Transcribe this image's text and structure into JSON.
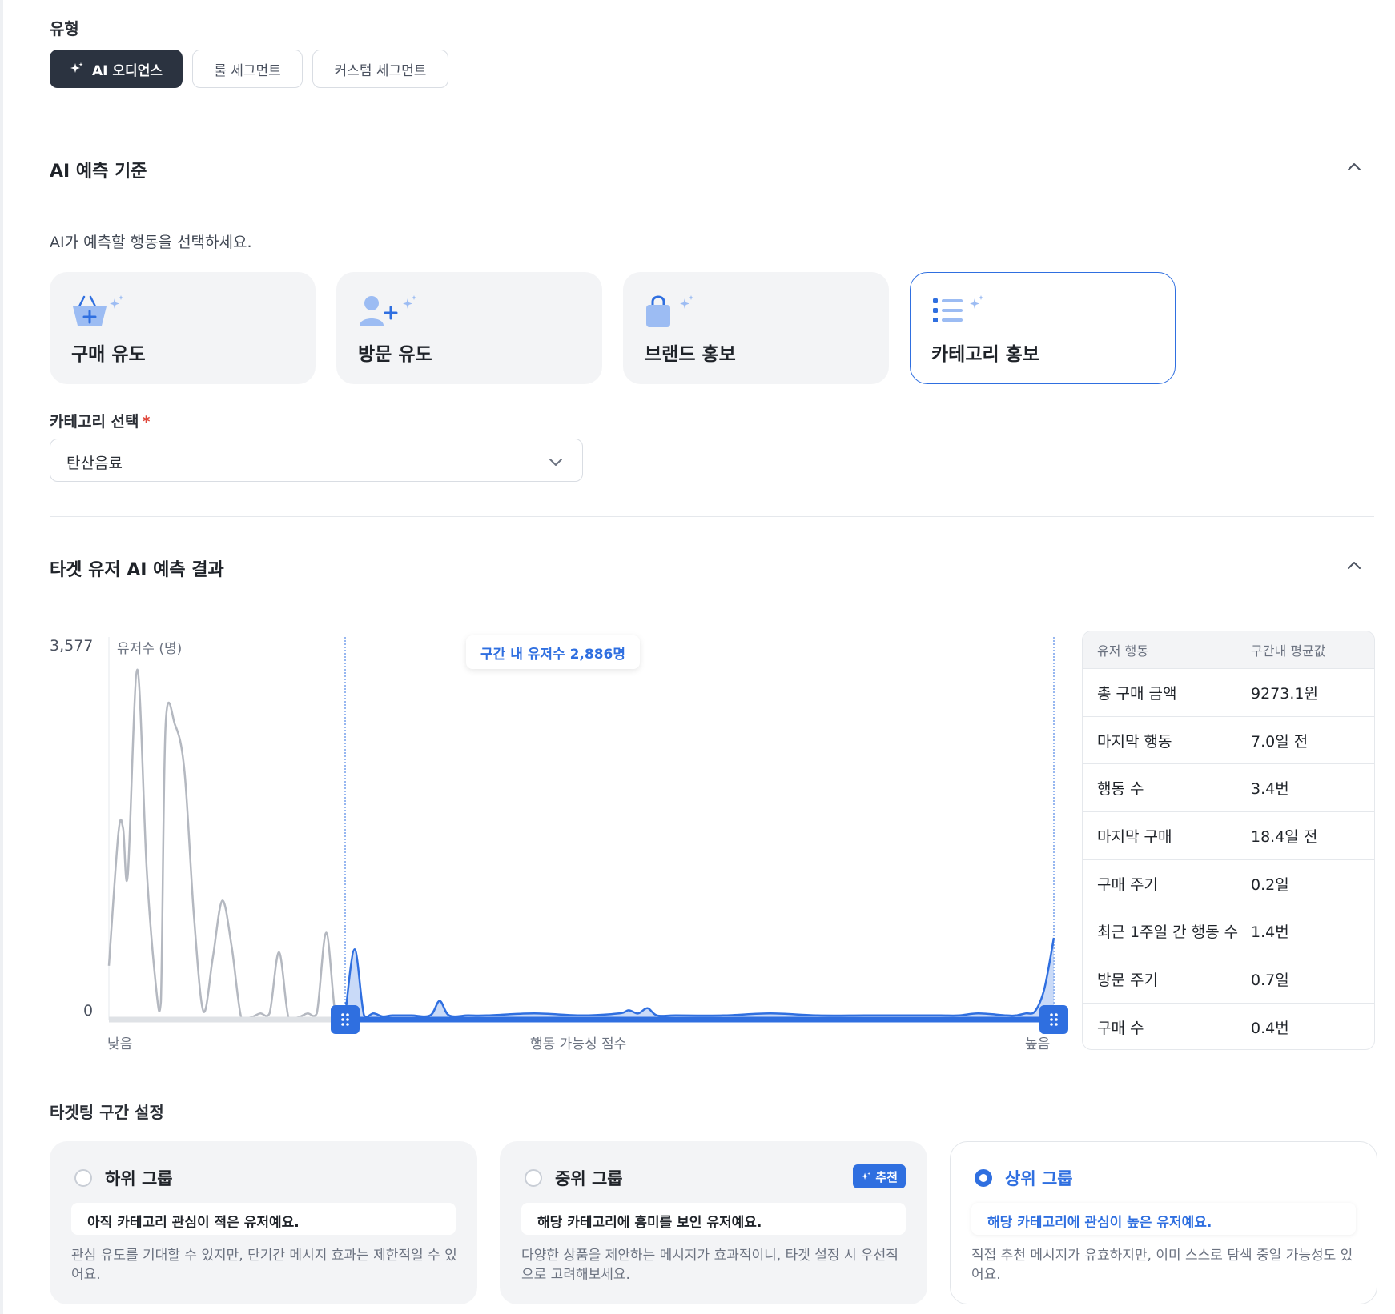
{
  "type_section": {
    "label": "유형",
    "tabs": [
      {
        "label": "AI 오디언스",
        "active": true,
        "icon": "sparkle-icon"
      },
      {
        "label": "룰 세그먼트",
        "active": false
      },
      {
        "label": "커스텀 세그먼트",
        "active": false
      }
    ]
  },
  "prediction": {
    "title": "AI 예측 기준",
    "hint": "AI가 예측할 행동을 선택하세요.",
    "options": [
      {
        "label": "구매 유도",
        "icon": "basket-plus-icon",
        "selected": false
      },
      {
        "label": "방문 유도",
        "icon": "user-plus-icon",
        "selected": false
      },
      {
        "label": "브랜드 홍보",
        "icon": "shopping-bag-icon",
        "selected": false
      },
      {
        "label": "카테고리 홍보",
        "icon": "list-icon",
        "selected": true
      }
    ],
    "category_label": "카테고리 선택",
    "required_mark": "*",
    "category_value": "탄산음료"
  },
  "result": {
    "title": "타겟 유저 AI 예측 결과"
  },
  "chart_data": {
    "type": "area",
    "y_axis_title": "유저수 (명)",
    "ylim": [
      0,
      3577
    ],
    "y_ticks": [
      "3,577",
      "0"
    ],
    "x_axis_title": "행동 가능성 점수",
    "x_tick_low": "낮음",
    "x_tick_high": "높음",
    "xlim": [
      0,
      100
    ],
    "selected_range": [
      25,
      100
    ],
    "range_label": "구간 내 유저수 2,886명",
    "series": [
      {
        "x": [
          0,
          1,
          1.5,
          2,
          3,
          4,
          5,
          5.5,
          6,
          7,
          8,
          9,
          10,
          11,
          12,
          13,
          14,
          15,
          16,
          17,
          18,
          19,
          20,
          21,
          22,
          23,
          24,
          25,
          26,
          27,
          28,
          29,
          30,
          32,
          34,
          35,
          36,
          38,
          40,
          45,
          50,
          54,
          55,
          56,
          57,
          58,
          60,
          65,
          70,
          75,
          80,
          85,
          88,
          90,
          92,
          95,
          96,
          97,
          98,
          99,
          100
        ],
        "values": [
          520,
          1800,
          1850,
          1400,
          3385,
          1450,
          300,
          170,
          2850,
          2850,
          2400,
          1000,
          80,
          600,
          1150,
          700,
          20,
          20,
          60,
          60,
          650,
          20,
          20,
          60,
          60,
          840,
          30,
          40,
          680,
          40,
          60,
          30,
          40,
          40,
          40,
          180,
          40,
          40,
          40,
          60,
          40,
          60,
          90,
          60,
          110,
          40,
          40,
          40,
          60,
          40,
          40,
          40,
          40,
          40,
          60,
          40,
          40,
          60,
          80,
          300,
          790
        ]
      }
    ]
  },
  "stats_table": {
    "headers": [
      "유저 행동",
      "구간내 평균값"
    ],
    "rows": [
      [
        "총 구매 금액",
        "9273.1원"
      ],
      [
        "마지막 행동",
        "7.0일 전"
      ],
      [
        "행동 수",
        "3.4번"
      ],
      [
        "마지막 구매",
        "18.4일 전"
      ],
      [
        "구매 주기",
        "0.2일"
      ],
      [
        "최근 1주일 간 행동 수",
        "1.4번"
      ],
      [
        "방문 주기",
        "0.7일"
      ],
      [
        "구매 수",
        "0.4번"
      ]
    ]
  },
  "targeting": {
    "title": "타겟팅 구간 설정",
    "groups": [
      {
        "title": "하위 그룹",
        "desc": "아직 카테고리 관심이 적은 유저예요.",
        "note": "관심 유도를 기대할 수 있지만, 단기간 메시지 효과는 제한적일 수 있어요.",
        "selected": false
      },
      {
        "title": "중위 그룹",
        "desc": "해당 카테고리에 흥미를 보인 유저예요.",
        "note": "다양한 상품을 제안하는 메시지가 효과적이니, 타겟 설정 시 우선적으로 고려해보세요.",
        "selected": false,
        "badge": "추천"
      },
      {
        "title": "상위 그룹",
        "desc": "해당 카테고리에 관심이 높은 유저예요.",
        "note": "직접 추천 메시지가 유효하지만, 이미 스스로 탐색 중일 가능성도 있어요.",
        "selected": true
      }
    ]
  },
  "colors": {
    "accent": "#2f6fe0",
    "dark_tab": "#2b3340",
    "gray_curve": "#b4b8c0"
  }
}
